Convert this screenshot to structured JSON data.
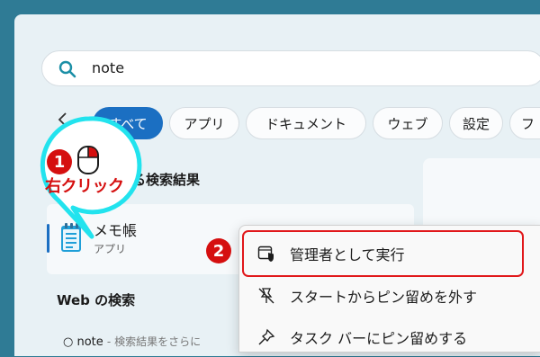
{
  "search": {
    "query": "note"
  },
  "filters": [
    "すべて",
    "アプリ",
    "ドキュメント",
    "ウェブ",
    "設定",
    "フ"
  ],
  "sections": {
    "best_match": "る検索結果",
    "web": "Web の検索"
  },
  "result": {
    "name": "メモ帳",
    "type": "アプリ"
  },
  "web_result": {
    "query": "note",
    "hint": "- 検索結果をさらに"
  },
  "context_menu": [
    {
      "label": "管理者として実行",
      "icon": "shield-window-icon"
    },
    {
      "label": "スタートからピン留めを外す",
      "icon": "unpin-icon"
    },
    {
      "label": "タスク バーにピン留めする",
      "icon": "pin-icon"
    }
  ],
  "annotation": {
    "step1": "1",
    "step2": "2",
    "right_click": "右クリック"
  },
  "colors": {
    "accent": "#1b6fc2",
    "annotation_red": "#d50f0f",
    "callout_cyan": "#22e3ee"
  }
}
